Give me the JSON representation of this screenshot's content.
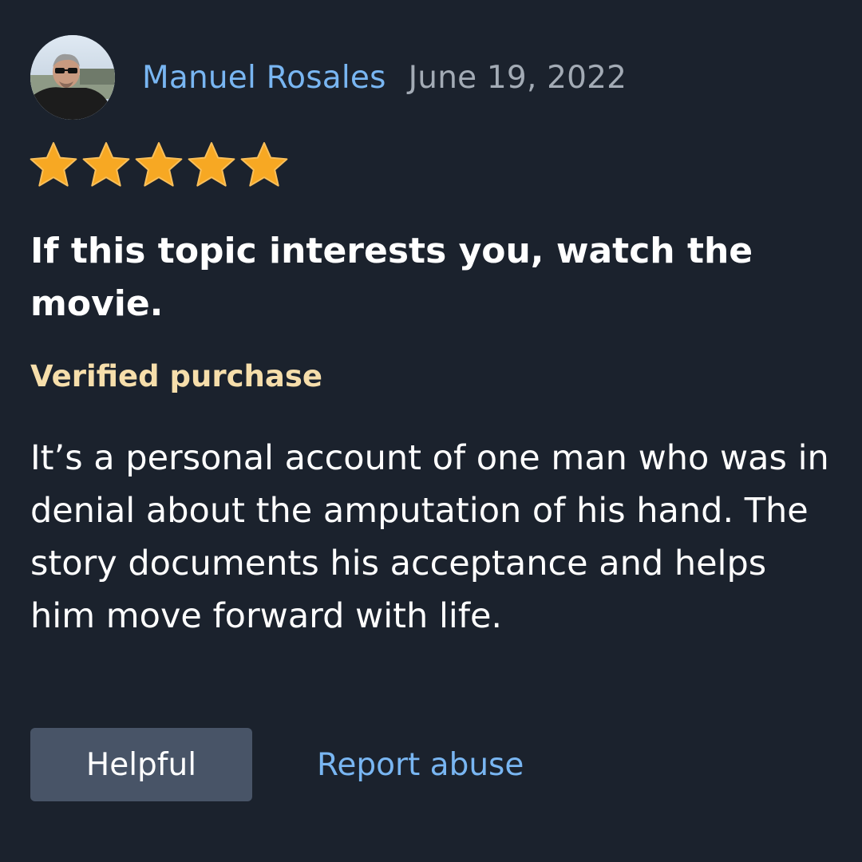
{
  "reviewer": {
    "name": "Manuel Rosales",
    "date": "June 19, 2022"
  },
  "rating": {
    "value": 5,
    "max": 5,
    "star_icon": "star-icon",
    "star_color": "#f7a823"
  },
  "review": {
    "title": "If this topic interests you, watch the movie.",
    "verified_label": "Verified purchase",
    "body": "It’s a personal account of one man who was in denial about the amputation of his hand. The story documents his acceptance and helps him move forward with life."
  },
  "actions": {
    "helpful_label": "Helpful",
    "report_label": "Report abuse"
  },
  "colors": {
    "background": "#1b222d",
    "link": "#79b6f2",
    "date": "#a3abb5",
    "verified": "#f6deab",
    "button_bg": "#485467"
  }
}
